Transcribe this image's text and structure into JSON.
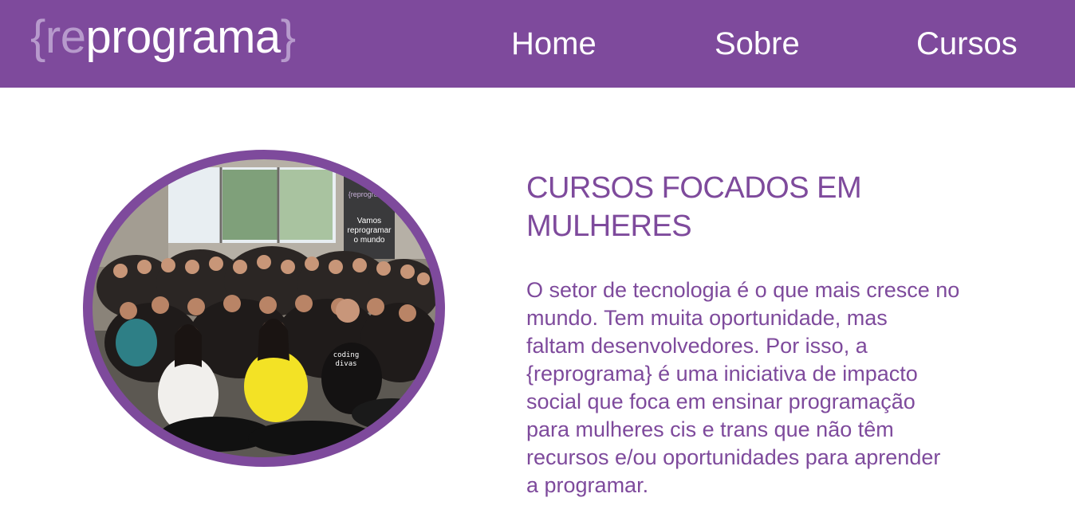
{
  "header": {
    "logo": {
      "open_brace": "{",
      "re": "re",
      "programa": "programa",
      "close_brace": "}"
    },
    "nav": [
      "Home",
      "Sobre",
      "Cursos"
    ]
  },
  "main": {
    "title_lines": [
      "CURSOS FOCADOS EM",
      "MULHERES"
    ],
    "body_lines": [
      "O setor de tecnologia é o que mais cresce no",
      "mundo. Tem muita oportunidade, mas",
      "faltam desenvolvedores. Por isso, a",
      "{reprograma} é uma iniciativa de impacto",
      "social que foca em ensinar programação",
      "para mulheres cis e trans que não têm",
      "recursos e/ou oportunidades para aprender",
      "a programar."
    ],
    "photo": {
      "banner_brand": "{reprograma}",
      "banner_text": [
        "Vamos",
        "reprogramar",
        "o mundo"
      ],
      "shirt_text": [
        "coding",
        "divas"
      ]
    }
  },
  "colors": {
    "brand_purple": "#7e4a9c",
    "logo_accent": "#b79acc",
    "background": "#ffffff"
  }
}
